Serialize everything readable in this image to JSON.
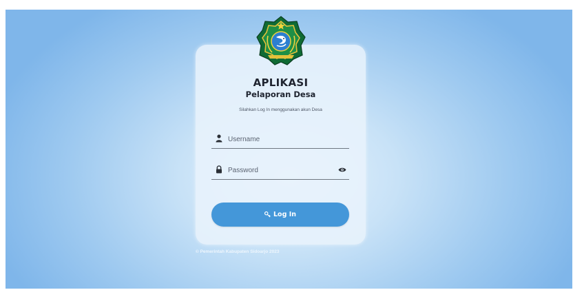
{
  "app": {
    "title": "APLIKASI",
    "subtitle": "Pelaporan Desa",
    "hint": "Silahkan Log In menggunakan akun Desa"
  },
  "form": {
    "username": {
      "placeholder": "Username",
      "value": "",
      "icon": "user-icon"
    },
    "password": {
      "placeholder": "Password",
      "value": "",
      "icon": "lock-icon",
      "toggle_icon": "eye-icon"
    },
    "login_label": "Log In",
    "login_icon": "key-icon"
  },
  "footer": {
    "text": "© Pemerintah Kabupaten Sidoarjo 2023"
  },
  "colors": {
    "button": "#4497d9",
    "background_center": "#e3f1fc",
    "background_edge": "#7fb6ea",
    "card": "#e8f3fc",
    "logo_shield": "#0f6b34"
  }
}
